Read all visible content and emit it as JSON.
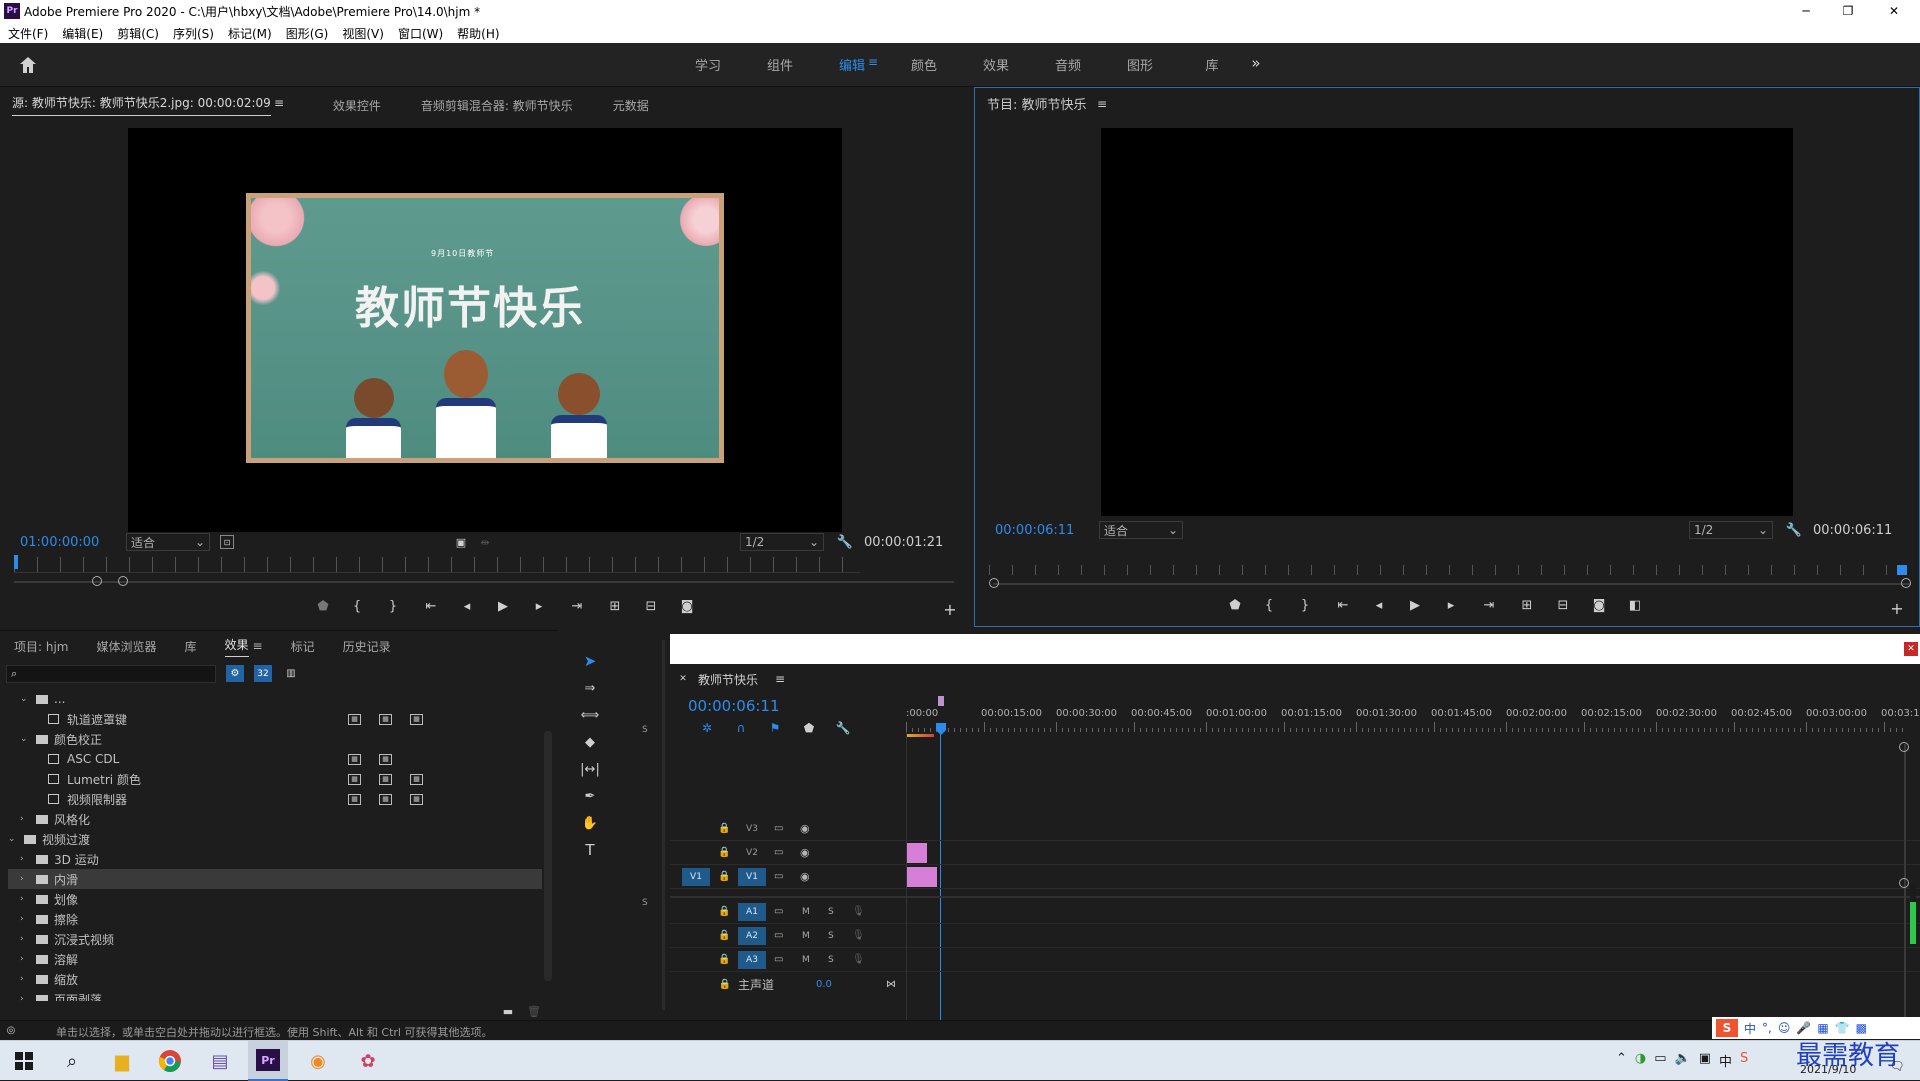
{
  "window": {
    "title": "Adobe Premiere Pro 2020 - C:\\用户\\hbxy\\文档\\Adobe\\Premiere Pro\\14.0\\hjm *",
    "app_badge": "Pr"
  },
  "menu": [
    "文件(F)",
    "编辑(E)",
    "剪辑(C)",
    "序列(S)",
    "标记(M)",
    "图形(G)",
    "视图(V)",
    "窗口(W)",
    "帮助(H)"
  ],
  "workspaces": [
    {
      "label": "学习",
      "active": false
    },
    {
      "label": "组件",
      "active": false
    },
    {
      "label": "编辑",
      "active": true
    },
    {
      "label": "颜色",
      "active": false
    },
    {
      "label": "效果",
      "active": false
    },
    {
      "label": "音频",
      "active": false
    },
    {
      "label": "图形",
      "active": false
    },
    {
      "label": "库",
      "active": false
    }
  ],
  "source_panel": {
    "tabs": [
      "源: 教师节快乐: 教师节快乐2.jpg: 00:00:02:09",
      "效果控件",
      "音频剪辑混合器: 教师节快乐",
      "元数据"
    ],
    "timecode": "01:00:00:00",
    "fit": "适合",
    "resolution": "1/2",
    "duration": "00:00:01:21",
    "image": {
      "date_text": "9月10日教师节",
      "headline": "教师节快乐"
    }
  },
  "program_panel": {
    "title": "节目: 教师节快乐",
    "timecode": "00:00:06:11",
    "fit": "适合",
    "resolution": "1/2",
    "duration": "00:00:06:11"
  },
  "project_panel": {
    "tabs": [
      "项目: hjm",
      "媒体浏览器",
      "库",
      "效果",
      "标记",
      "历史记录"
    ],
    "active_tab": "效果",
    "tree": [
      {
        "label": "...",
        "level": 1,
        "type": "folder",
        "expanded": true,
        "selected": false
      },
      {
        "label": "轨道遮罩键",
        "level": 2,
        "type": "effect",
        "badges": 3,
        "selected": false
      },
      {
        "label": "颜色校正",
        "level": 1,
        "type": "folder",
        "expanded": true,
        "selected": false
      },
      {
        "label": "ASC CDL",
        "level": 2,
        "type": "effect",
        "badges": 2,
        "selected": false
      },
      {
        "label": "Lumetri 颜色",
        "level": 2,
        "type": "effect",
        "badges": 3,
        "selected": false
      },
      {
        "label": "视频限制器",
        "level": 2,
        "type": "effect",
        "badges": 3,
        "selected": false
      },
      {
        "label": "风格化",
        "level": 1,
        "type": "folder",
        "expanded": false,
        "selected": false
      },
      {
        "label": "视频过渡",
        "level": 0,
        "type": "folder",
        "expanded": true,
        "selected": false
      },
      {
        "label": "3D 运动",
        "level": 1,
        "type": "folder",
        "expanded": false,
        "selected": false
      },
      {
        "label": "内滑",
        "level": 1,
        "type": "folder",
        "expanded": false,
        "selected": true
      },
      {
        "label": "划像",
        "level": 1,
        "type": "folder",
        "expanded": false,
        "selected": false
      },
      {
        "label": "擦除",
        "level": 1,
        "type": "folder",
        "expanded": false,
        "selected": false
      },
      {
        "label": "沉浸式视频",
        "level": 1,
        "type": "folder",
        "expanded": false,
        "selected": false
      },
      {
        "label": "溶解",
        "level": 1,
        "type": "folder",
        "expanded": false,
        "selected": false
      },
      {
        "label": "缩放",
        "level": 1,
        "type": "folder",
        "expanded": false,
        "selected": false
      },
      {
        "label": "页面剥落",
        "level": 1,
        "type": "folder",
        "expanded": false,
        "selected": false
      }
    ]
  },
  "timeline": {
    "sequence_name": "教师节快乐",
    "timecode": "00:00:06:11",
    "ruler": [
      ":00:00",
      "00:00:15:00",
      "00:00:30:00",
      "00:00:45:00",
      "00:01:00:00",
      "00:01:15:00",
      "00:01:30:00",
      "00:01:45:00",
      "00:02:00:00",
      "00:02:15:00",
      "00:02:30:00",
      "00:02:45:00",
      "00:03:00:00",
      "00:03:15:"
    ],
    "video_tracks": [
      {
        "name": "V3",
        "target": false,
        "clip": false
      },
      {
        "name": "V2",
        "target": false,
        "clip": true
      },
      {
        "name": "V1",
        "target": true,
        "clip": true
      }
    ],
    "audio_tracks": [
      {
        "name": "A1",
        "mute": "M",
        "solo": "S"
      },
      {
        "name": "A2",
        "mute": "M",
        "solo": "S"
      },
      {
        "name": "A3",
        "mute": "M",
        "solo": "S"
      }
    ],
    "master": {
      "label": "主声道",
      "value": "0.0"
    },
    "clip_color": "#d67fd6"
  },
  "side_markers": {
    "s1": "S",
    "s2": "S"
  },
  "status_bar": {
    "text": "单击以选择，或单击空白处并拖动以进行框选。使用 Shift、Alt 和 Ctrl 可获得其他选项。"
  },
  "taskbar": {
    "date": "2021/9/10",
    "ime_label": "中",
    "watermark": "最需教育"
  },
  "colors": {
    "accent": "#2d8ceb",
    "panel": "#1d1d1d",
    "clip": "#d67fd6"
  }
}
